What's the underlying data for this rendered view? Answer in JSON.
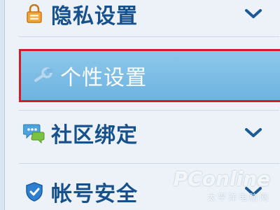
{
  "menu": {
    "items": [
      {
        "label": "隐私设置",
        "icon": "lock-icon",
        "has_chevron": true,
        "active": false
      },
      {
        "label": "个性设置",
        "icon": "wrench-icon",
        "has_chevron": false,
        "active": true
      },
      {
        "label": "社区绑定",
        "icon": "chat-icon",
        "has_chevron": true,
        "active": false
      },
      {
        "label": "帐号安全",
        "icon": "shield-icon",
        "has_chevron": true,
        "active": false
      }
    ]
  },
  "colors": {
    "label": "#16508d",
    "active_bg": "#7bbde5",
    "highlight_border": "#d51b2a"
  },
  "watermark": {
    "logo": "PConline",
    "sub": "太平洋电脑网"
  }
}
